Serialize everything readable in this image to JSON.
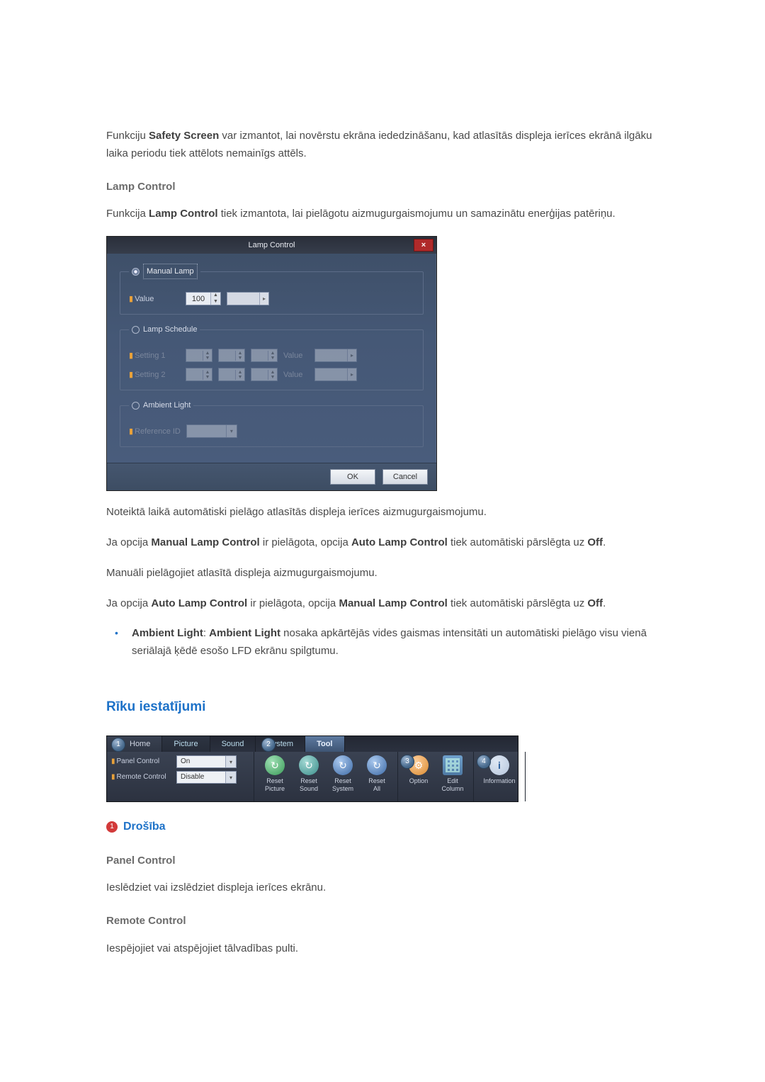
{
  "intro": {
    "p1_a": "Funkciju ",
    "p1_b": "Safety Screen",
    "p1_c": " var izmantot, lai novērstu ekrāna iededzināšanu, kad atlasītās displeja ierīces ekrānā ilgāku laika periodu tiek attēlots nemainīgs attēls."
  },
  "lamp": {
    "heading": "Lamp Control",
    "p1_a": "Funkcija ",
    "p1_b": "Lamp Control",
    "p1_c": " tiek izmantota, lai pielāgotu aizmugurgaismojumu un samazinātu enerģijas patēriņu."
  },
  "dialog": {
    "title": "Lamp Control",
    "close": "×",
    "manual_lamp_legend": "Manual Lamp",
    "value_label": "Value",
    "value_num": "100",
    "lamp_schedule_legend": "Lamp Schedule",
    "setting1_label": "Setting 1",
    "setting2_label": "Setting 2",
    "schedule_value_label": "Value",
    "ambient_legend": "Ambient Light",
    "reference_label": "Reference ID",
    "ok": "OK",
    "cancel": "Cancel"
  },
  "after": {
    "p1": "Noteiktā laikā automātiski pielāgo atlasītās displeja ierīces aizmugurgaismojumu.",
    "p2_a": "Ja opcija ",
    "p2_b": "Manual Lamp Control",
    "p2_c": " ir pielāgota, opcija ",
    "p2_d": "Auto Lamp Control",
    "p2_e": " tiek automātiski pārslēgta uz ",
    "p2_f": "Off",
    "p2_g": ".",
    "p3": "Manuāli pielāgojiet atlasītā displeja aizmugurgaismojumu.",
    "p4_a": "Ja opcija ",
    "p4_b": "Auto Lamp Control",
    "p4_c": " ir pielāgota, opcija ",
    "p4_d": "Manual Lamp Control",
    "p4_e": " tiek automātiski pārslēgta uz ",
    "p4_f": "Off",
    "p4_g": ".",
    "bullet_a": "Ambient Light",
    "bullet_b": ": ",
    "bullet_c": "Ambient Light",
    "bullet_d": " nosaka apkārtējās vides gaismas intensitāti un automātiski pielāgo visu vienā seriālajā ķēdē esošo LFD ekrānu spilgtumu."
  },
  "tools": {
    "heading": "Rīku iestatījumi"
  },
  "ribbon": {
    "markers": {
      "m1": "1",
      "m2": "2",
      "m3": "3",
      "m4": "4"
    },
    "tabs": {
      "home": "Home",
      "picture": "Picture",
      "sound": "Sound",
      "system": "System",
      "tool": "Tool"
    },
    "panel_control_label": "Panel Control",
    "panel_control_value": "On",
    "remote_control_label": "Remote Control",
    "remote_control_value": "Disable",
    "reset_picture": "Reset\nPicture",
    "reset_sound": "Reset\nSound",
    "reset_system": "Reset\nSystem",
    "reset_all": "Reset\nAll",
    "option": "Option",
    "edit_column": "Edit\nColumn",
    "information": "Information"
  },
  "security": {
    "badge": "1",
    "heading": "Drošība",
    "panel_heading": "Panel Control",
    "panel_text": "Ieslēdziet vai izslēdziet displeja ierīces ekrānu.",
    "remote_heading": "Remote Control",
    "remote_text": "Iespējojiet vai atspējojiet tālvadības pulti."
  }
}
